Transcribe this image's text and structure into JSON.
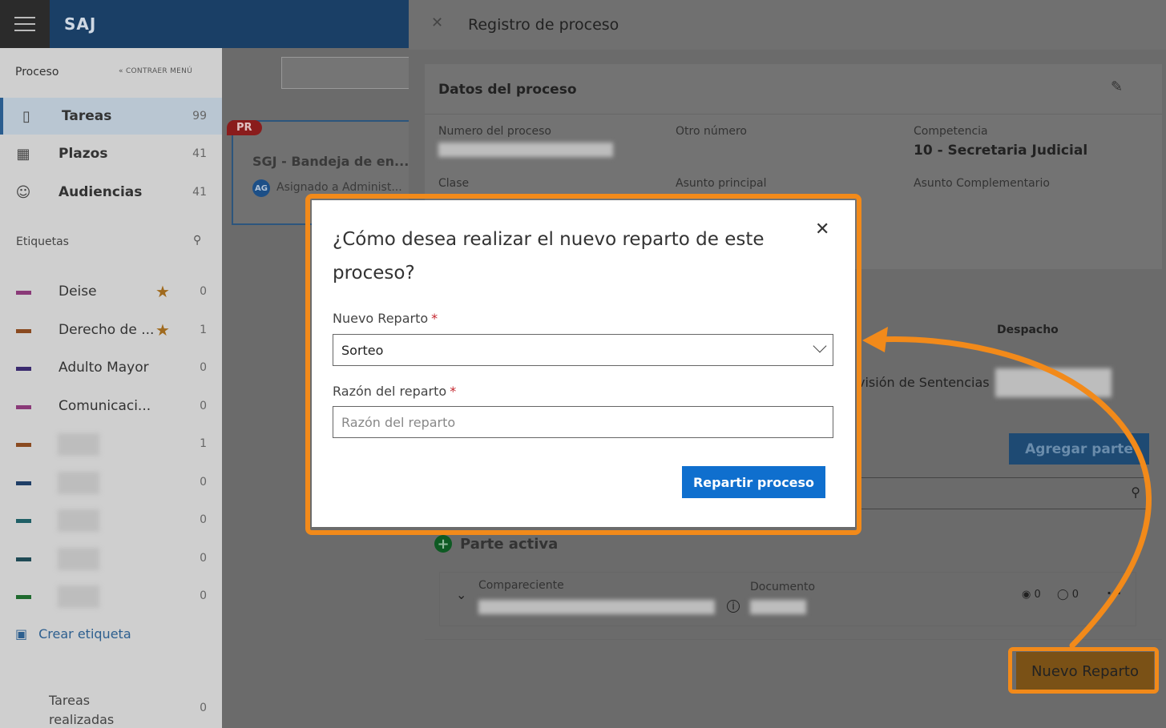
{
  "app": {
    "brand": "SAJ"
  },
  "sidebar": {
    "header": "Proceso",
    "collapse": "« CONTRAER MENÚ",
    "nav": [
      {
        "label": "Tareas",
        "count": "99",
        "icon": "book-icon"
      },
      {
        "label": "Plazos",
        "count": "41",
        "icon": "calendar-icon"
      },
      {
        "label": "Audiencias",
        "count": "41",
        "icon": "people-icon"
      }
    ],
    "tags_title": "Etiquetas",
    "tags": [
      {
        "name": "Deise",
        "count": "0",
        "starred": true,
        "color": "#8a3a78"
      },
      {
        "name": "Derecho de ...",
        "count": "1",
        "starred": true,
        "color": "#8a4a20"
      },
      {
        "name": "Adulto Mayor",
        "count": "0",
        "starred": false,
        "color": "#3a2a6e"
      },
      {
        "name": "Comunicaci...",
        "count": "0",
        "starred": false,
        "color": "#8a3a78"
      },
      {
        "name": "",
        "count": "1",
        "starred": false,
        "color": "#8a4a20"
      },
      {
        "name": "",
        "count": "0",
        "starred": false,
        "color": "#1f3e66"
      },
      {
        "name": "",
        "count": "0",
        "starred": false,
        "color": "#1f5f66"
      },
      {
        "name": "",
        "count": "0",
        "starred": false,
        "color": "#1f4a55"
      },
      {
        "name": "",
        "count": "0",
        "starred": false,
        "color": "#1f6a2e"
      }
    ],
    "create_tag": "Crear etiqueta",
    "done_label": "Tareas realizadas",
    "done_count": "0"
  },
  "list": {
    "card": {
      "badge": "PR",
      "title": "SGJ - Bandeja de en...",
      "avatar": "AG",
      "assigned": "Asignado a Administ..."
    }
  },
  "panel": {
    "title": "Registro de proceso",
    "section_title": "Datos del proceso",
    "fields": {
      "numero_label": "Numero del proceso",
      "otro_label": "Otro número",
      "competencia_label": "Competencia",
      "competencia_value": "10 - Secretaria Judicial",
      "clase_label": "Clase",
      "asunto_label": "Asunto principal",
      "asunto_comp_label": "Asunto Complementario"
    },
    "table_col": "Despacho",
    "row_text": "visión de Sentencias",
    "add_party": "Agregar parte",
    "party_section": "Parte activa",
    "row_labels": {
      "compareciente": "Compareciente",
      "documento": "Documento"
    },
    "row_counts": {
      "users": "0",
      "comments": "0"
    },
    "new_button": "Nuevo Reparto"
  },
  "dialog": {
    "title": "¿Cómo desea realizar el nuevo reparto de este proceso?",
    "field1_label": "Nuevo Reparto",
    "field1_value": "Sorteo",
    "field2_label": "Razón del reparto",
    "field2_placeholder": "Razón del reparto",
    "submit_label": "Repartir proceso",
    "required_mark": "*"
  },
  "colors": {
    "highlight": "#f28a1a",
    "primary": "#0f6fce",
    "required": "#c4262e"
  }
}
